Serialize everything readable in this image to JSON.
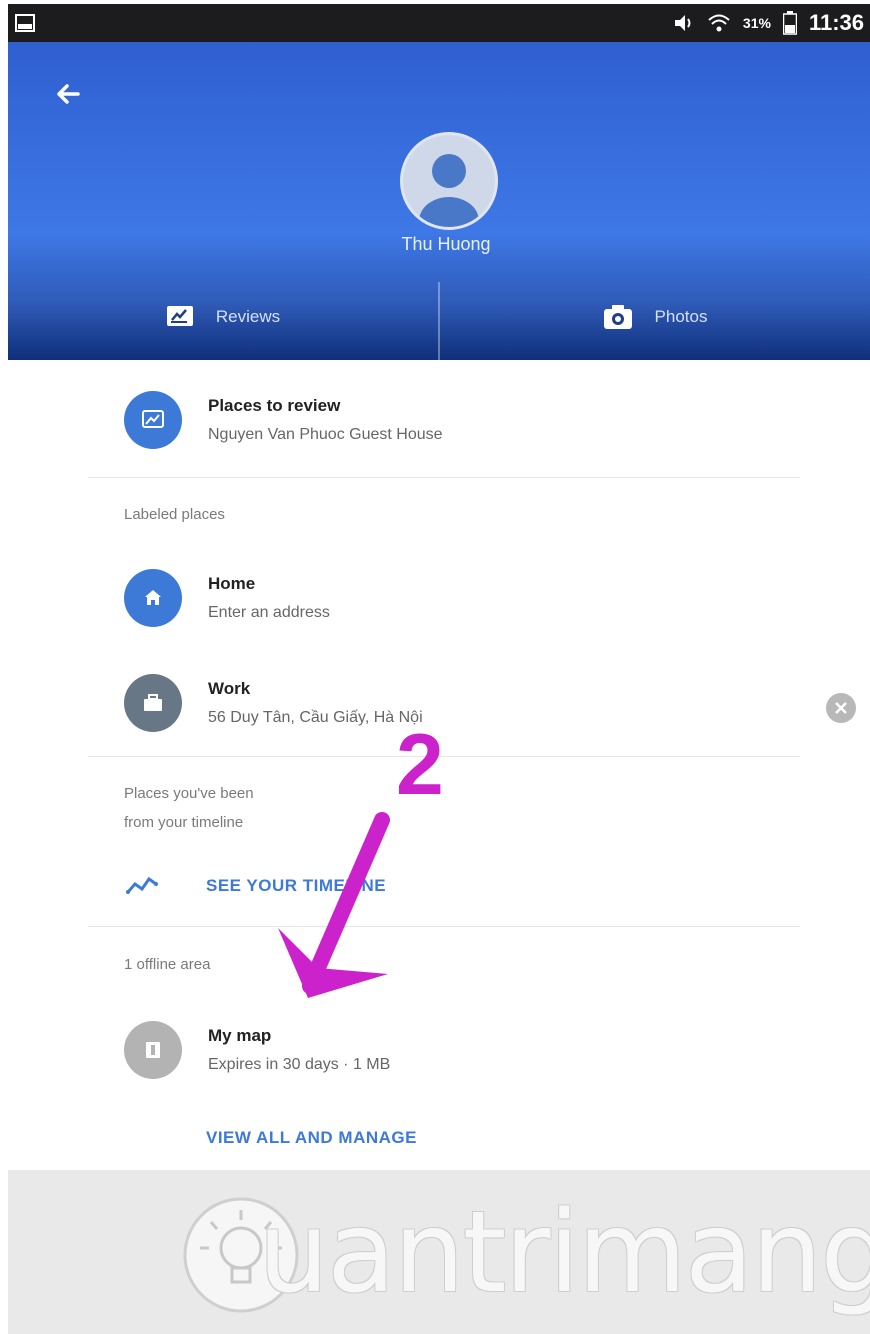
{
  "status_bar": {
    "battery_pct": "31%",
    "time": "11:36"
  },
  "profile": {
    "name": "Thu Huong"
  },
  "tabs": [
    {
      "label": "Reviews",
      "icon": "reviews-icon"
    },
    {
      "label": "Photos",
      "icon": "camera-icon"
    }
  ],
  "places_to_review": {
    "title": "Places to review",
    "subtitle": "Nguyen Van Phuoc Guest House"
  },
  "labeled_places": {
    "heading": "Labeled places",
    "items": [
      {
        "title": "Home",
        "subtitle": "Enter an address",
        "icon": "home-icon"
      },
      {
        "title": "Work",
        "subtitle": "56 Duy Tân, Cầu Giấy, Hà Nội",
        "icon": "briefcase-icon"
      }
    ]
  },
  "timeline": {
    "heading_line1": "Places you've been",
    "heading_line2": "from your timeline",
    "link": "SEE YOUR TIMELINE"
  },
  "offline": {
    "heading": "1 offline area",
    "item_title": "My map",
    "item_subtitle": "Expires in 30 days · 1 MB",
    "link": "VIEW ALL AND MANAGE"
  },
  "annotation": {
    "number": "2"
  },
  "watermark": {
    "text": "uantrimang"
  },
  "colors": {
    "accent_blue": "#3d7ad8",
    "header_blue": "#3e78e6",
    "annotation_magenta": "#cc22cc"
  }
}
